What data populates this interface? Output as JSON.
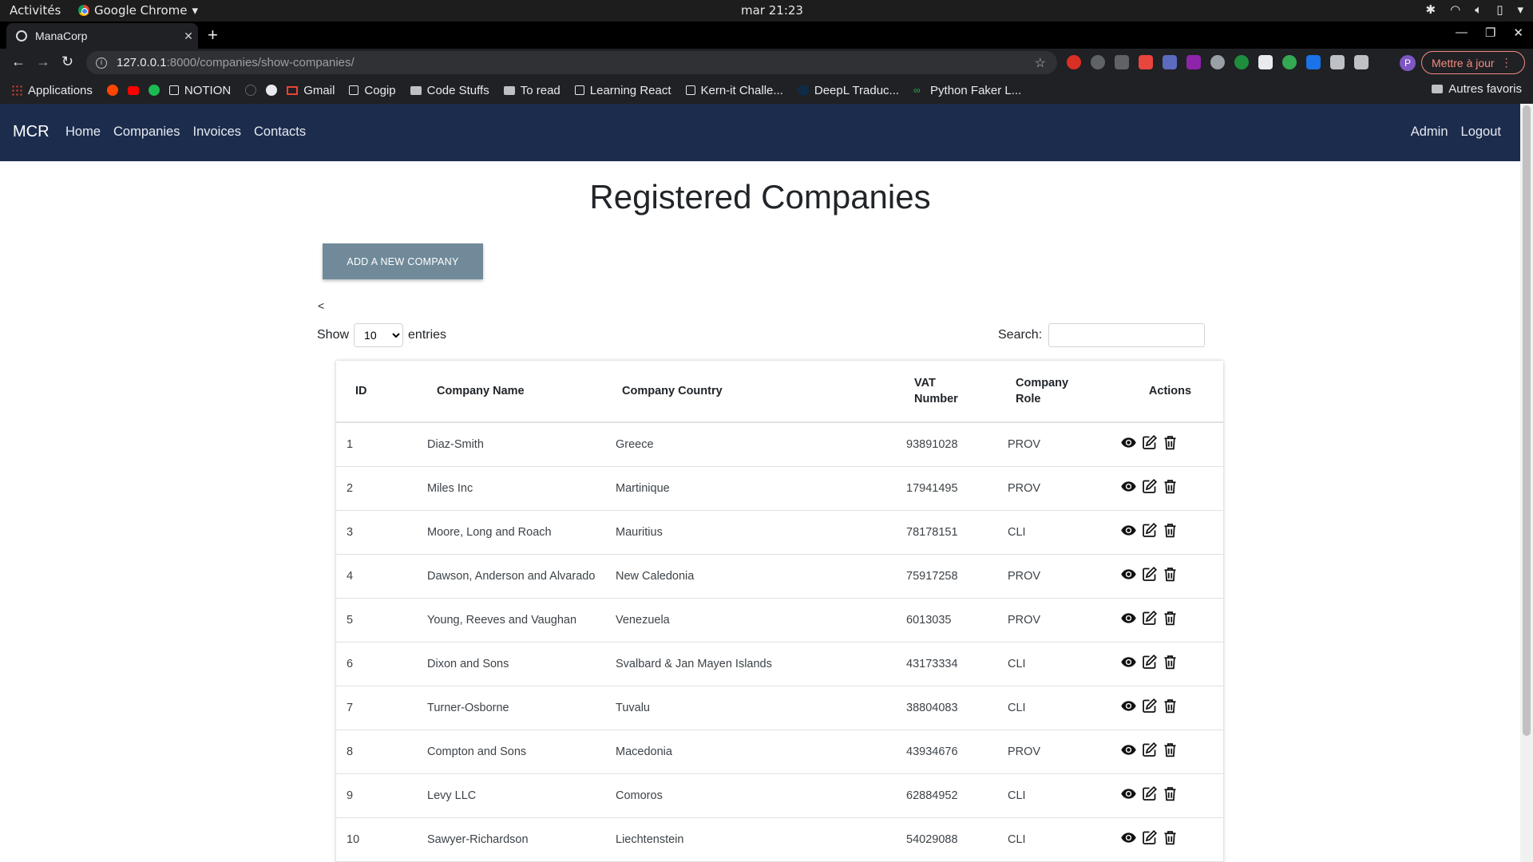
{
  "os": {
    "activities": "Activités",
    "app": "Google Chrome",
    "clock": "mar 21:23"
  },
  "browser": {
    "tab_title": "ManaCorp",
    "url_host": "127.0.0.1",
    "url_path": ":8000/companies/show-companies/",
    "update_label": "Mettre à jour",
    "profile_initial": "P",
    "bookmarks": [
      "Applications",
      "NOTION",
      "Gmail",
      "Cogip",
      "Code Stuffs",
      "To read",
      "Learning React",
      "Kern-it Challe...",
      "DeepL Traduc...",
      "Python Faker L..."
    ],
    "other_bookmarks": "Autres favoris"
  },
  "navbar": {
    "brand": "MCR",
    "links": [
      "Home",
      "Companies",
      "Invoices",
      "Contacts"
    ],
    "right_links": [
      "Admin",
      "Logout"
    ]
  },
  "page": {
    "title": "Registered Companies",
    "add_button": "ADD A NEW COMPANY",
    "back_mark": "<",
    "show_label": "Show",
    "entries_label": "entries",
    "page_size": "10",
    "search_label": "Search:"
  },
  "table": {
    "headers": {
      "id": "ID",
      "name": "Company Name",
      "country": "Company Country",
      "vat_1": "VAT",
      "vat_2": "Number",
      "role_1": "Company",
      "role_2": "Role",
      "actions": "Actions"
    },
    "rows": [
      {
        "id": "1",
        "name": "Diaz-Smith",
        "country": "Greece",
        "vat": "93891028",
        "role": "PROV"
      },
      {
        "id": "2",
        "name": "Miles Inc",
        "country": "Martinique",
        "vat": "17941495",
        "role": "PROV"
      },
      {
        "id": "3",
        "name": "Moore, Long and Roach",
        "country": "Mauritius",
        "vat": "78178151",
        "role": "CLI"
      },
      {
        "id": "4",
        "name": "Dawson, Anderson and Alvarado",
        "country": "New Caledonia",
        "vat": "75917258",
        "role": "PROV"
      },
      {
        "id": "5",
        "name": "Young, Reeves and Vaughan",
        "country": "Venezuela",
        "vat": "6013035",
        "role": "PROV"
      },
      {
        "id": "6",
        "name": "Dixon and Sons",
        "country": "Svalbard & Jan Mayen Islands",
        "vat": "43173334",
        "role": "CLI"
      },
      {
        "id": "7",
        "name": "Turner-Osborne",
        "country": "Tuvalu",
        "vat": "38804083",
        "role": "CLI"
      },
      {
        "id": "8",
        "name": "Compton and Sons",
        "country": "Macedonia",
        "vat": "43934676",
        "role": "PROV"
      },
      {
        "id": "9",
        "name": "Levy LLC",
        "country": "Comoros",
        "vat": "62884952",
        "role": "CLI"
      },
      {
        "id": "10",
        "name": "Sawyer-Richardson",
        "country": "Liechtenstein",
        "vat": "54029088",
        "role": "CLI"
      }
    ],
    "action_icons": [
      "eye-icon",
      "edit-icon",
      "trash-icon"
    ]
  },
  "colors": {
    "navbar": "#1c2c4d",
    "add_button": "#708a9a",
    "update_button": "#f28b82"
  }
}
